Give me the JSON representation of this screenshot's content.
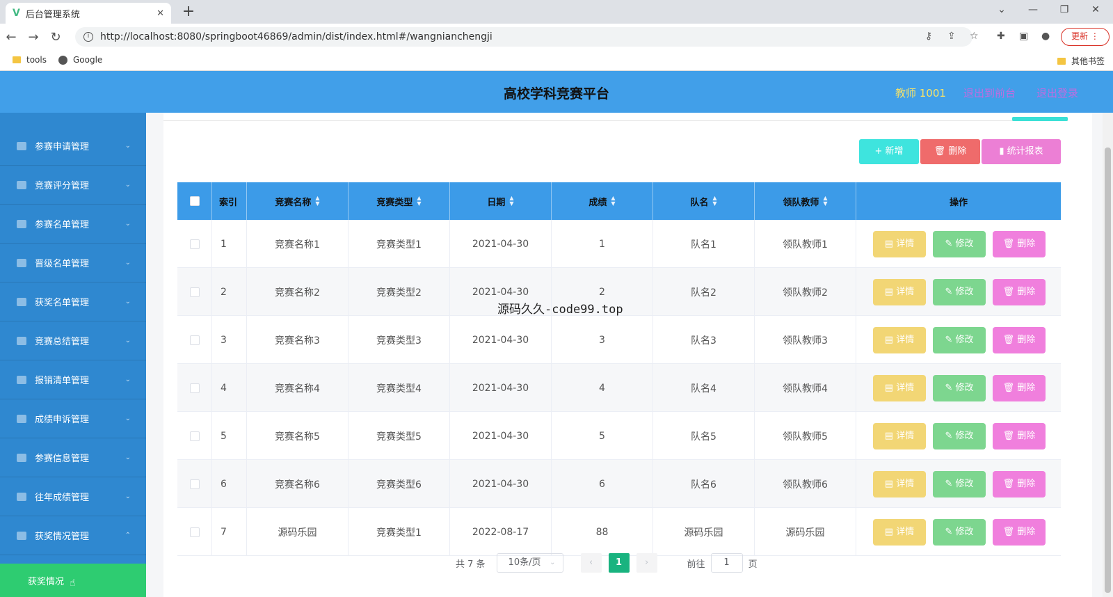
{
  "browser": {
    "tab_title": "后台管理系统",
    "url": "http://localhost:8080/springboot46869/admin/dist/index.html#/wangnianchengji",
    "update_label": "更新",
    "bookmarks": [
      "tools",
      "Google"
    ],
    "other_bookmarks": "其他书签"
  },
  "header": {
    "title": "高校学科竞赛平台",
    "user": "教师 1001",
    "exit_front": "退出到前台",
    "logout": "退出登录"
  },
  "sidebar": {
    "items": [
      {
        "label": "参赛申请管理"
      },
      {
        "label": "竞赛评分管理"
      },
      {
        "label": "参赛名单管理"
      },
      {
        "label": "晋级名单管理"
      },
      {
        "label": "获奖名单管理"
      },
      {
        "label": "竞赛总结管理"
      },
      {
        "label": "报销清单管理"
      },
      {
        "label": "成绩申诉管理"
      },
      {
        "label": "参赛信息管理"
      },
      {
        "label": "往年成绩管理"
      },
      {
        "label": "获奖情况管理"
      }
    ],
    "active_item": "获奖情况"
  },
  "toolbar": {
    "add": "+ 新增",
    "delete": "删除",
    "stats": "统计报表"
  },
  "table": {
    "headers": {
      "index": "索引",
      "name": "竞赛名称",
      "type": "竞赛类型",
      "date": "日期",
      "score": "成绩",
      "team": "队名",
      "teacher": "领队教师",
      "ops": "操作"
    },
    "rows": [
      {
        "idx": "1",
        "name": "竞赛名称1",
        "type": "竞赛类型1",
        "date": "2021-04-30",
        "score": "1",
        "team": "队名1",
        "teacher": "领队教师1"
      },
      {
        "idx": "2",
        "name": "竞赛名称2",
        "type": "竞赛类型2",
        "date": "2021-04-30",
        "score": "2",
        "team": "队名2",
        "teacher": "领队教师2"
      },
      {
        "idx": "3",
        "name": "竞赛名称3",
        "type": "竞赛类型3",
        "date": "2021-04-30",
        "score": "3",
        "team": "队名3",
        "teacher": "领队教师3"
      },
      {
        "idx": "4",
        "name": "竞赛名称4",
        "type": "竞赛类型4",
        "date": "2021-04-30",
        "score": "4",
        "team": "队名4",
        "teacher": "领队教师4"
      },
      {
        "idx": "5",
        "name": "竞赛名称5",
        "type": "竞赛类型5",
        "date": "2021-04-30",
        "score": "5",
        "team": "队名5",
        "teacher": "领队教师5"
      },
      {
        "idx": "6",
        "name": "竞赛名称6",
        "type": "竞赛类型6",
        "date": "2021-04-30",
        "score": "6",
        "team": "队名6",
        "teacher": "领队教师6"
      },
      {
        "idx": "7",
        "name": "源码乐园",
        "type": "竞赛类型1",
        "date": "2022-08-17",
        "score": "88",
        "team": "源码乐园",
        "teacher": "源码乐园"
      }
    ],
    "op_labels": {
      "detail": "详情",
      "edit": "修改",
      "delete": "删除"
    }
  },
  "pager": {
    "total": "共 7 条",
    "page_size": "10条/页",
    "current": "1",
    "goto_prefix": "前往",
    "goto_value": "1",
    "goto_suffix": "页"
  },
  "overlay": "源码久久-code99.top",
  "colors": {
    "header": "#419fe9",
    "sidebar": "#2f88d0",
    "active": "#2ecc71",
    "table_header": "#3c9be8"
  }
}
